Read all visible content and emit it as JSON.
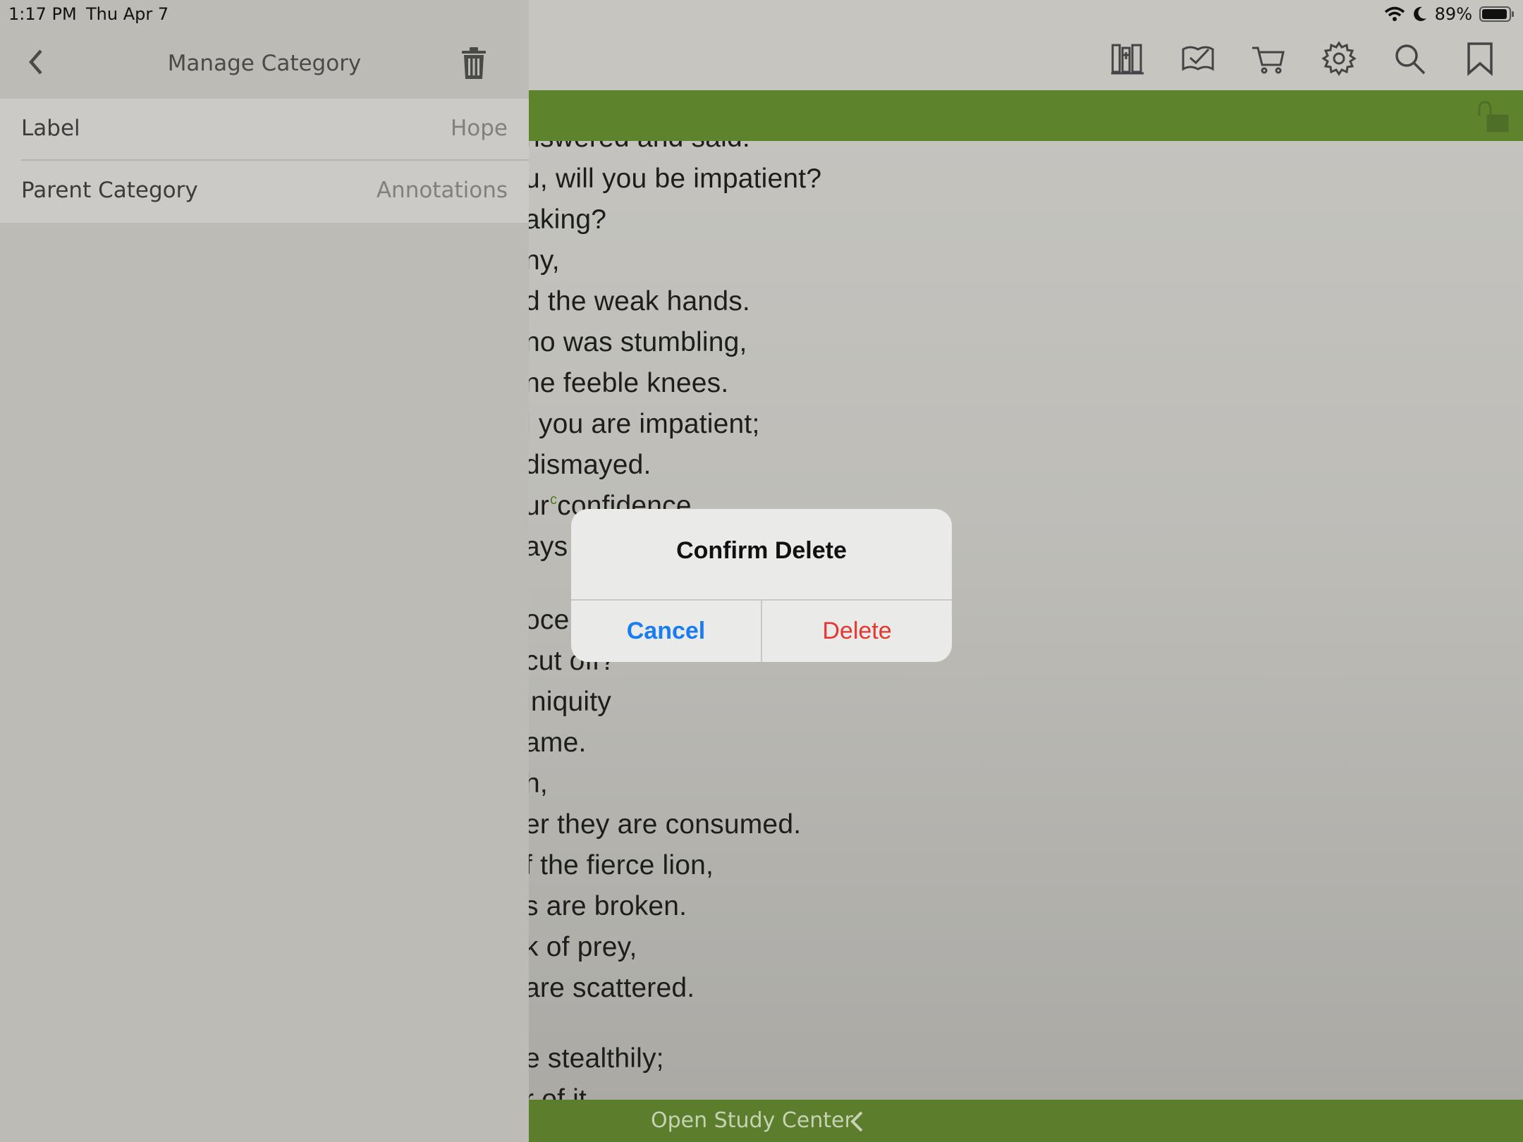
{
  "status_bar": {
    "time": "1:17 PM",
    "date": "Thu Apr 7",
    "battery": "89%"
  },
  "left_panel": {
    "title": "Manage Category",
    "rows": [
      {
        "label": "Label",
        "value": "Hope"
      },
      {
        "label": "Parent Category",
        "value": "Annotations"
      }
    ]
  },
  "toolbar": {
    "icons": [
      "library-icon",
      "reading-plan-icon",
      "cart-icon",
      "settings-gear-icon",
      "search-icon",
      "bookmark-icon"
    ]
  },
  "reader": {
    "lines": [
      {
        "text": "nswered and said:"
      },
      {
        "text": "u, will you be impatient?"
      },
      {
        "text": "aking?"
      },
      {
        "text": "ny,"
      },
      {
        "text": "d the weak hands."
      },
      {
        "text": "no was stumbling,"
      },
      {
        "text": "ne feeble knees."
      },
      {
        "text": "l you are impatient;"
      },
      {
        "text": " dismayed."
      },
      {
        "text": "ur  confidence"
      },
      {
        "text": "ays y"
      },
      {
        "text": ""
      },
      {
        "text": "oce"
      },
      {
        "text": "cut off?"
      },
      {
        "text": " iniquity"
      },
      {
        "text": "ame."
      },
      {
        "text": "h,"
      },
      {
        "text": "er they are consumed."
      },
      {
        "text": "f the fierce lion,"
      },
      {
        "text": "s are broken."
      },
      {
        "text": "k of prey,"
      },
      {
        "text": " are scattered."
      },
      {
        "text": ""
      },
      {
        "text": "e stealthily;"
      },
      {
        "text": "r of it"
      }
    ],
    "footnote_marker": "c"
  },
  "bottom_bar": {
    "label": "Open Study Center"
  },
  "dialog": {
    "title": "Confirm Delete",
    "cancel": "Cancel",
    "delete": "Delete"
  },
  "colors": {
    "accent_green": "#5e832d",
    "ios_blue": "#1a7cf2",
    "destructive_red": "#e53630"
  }
}
